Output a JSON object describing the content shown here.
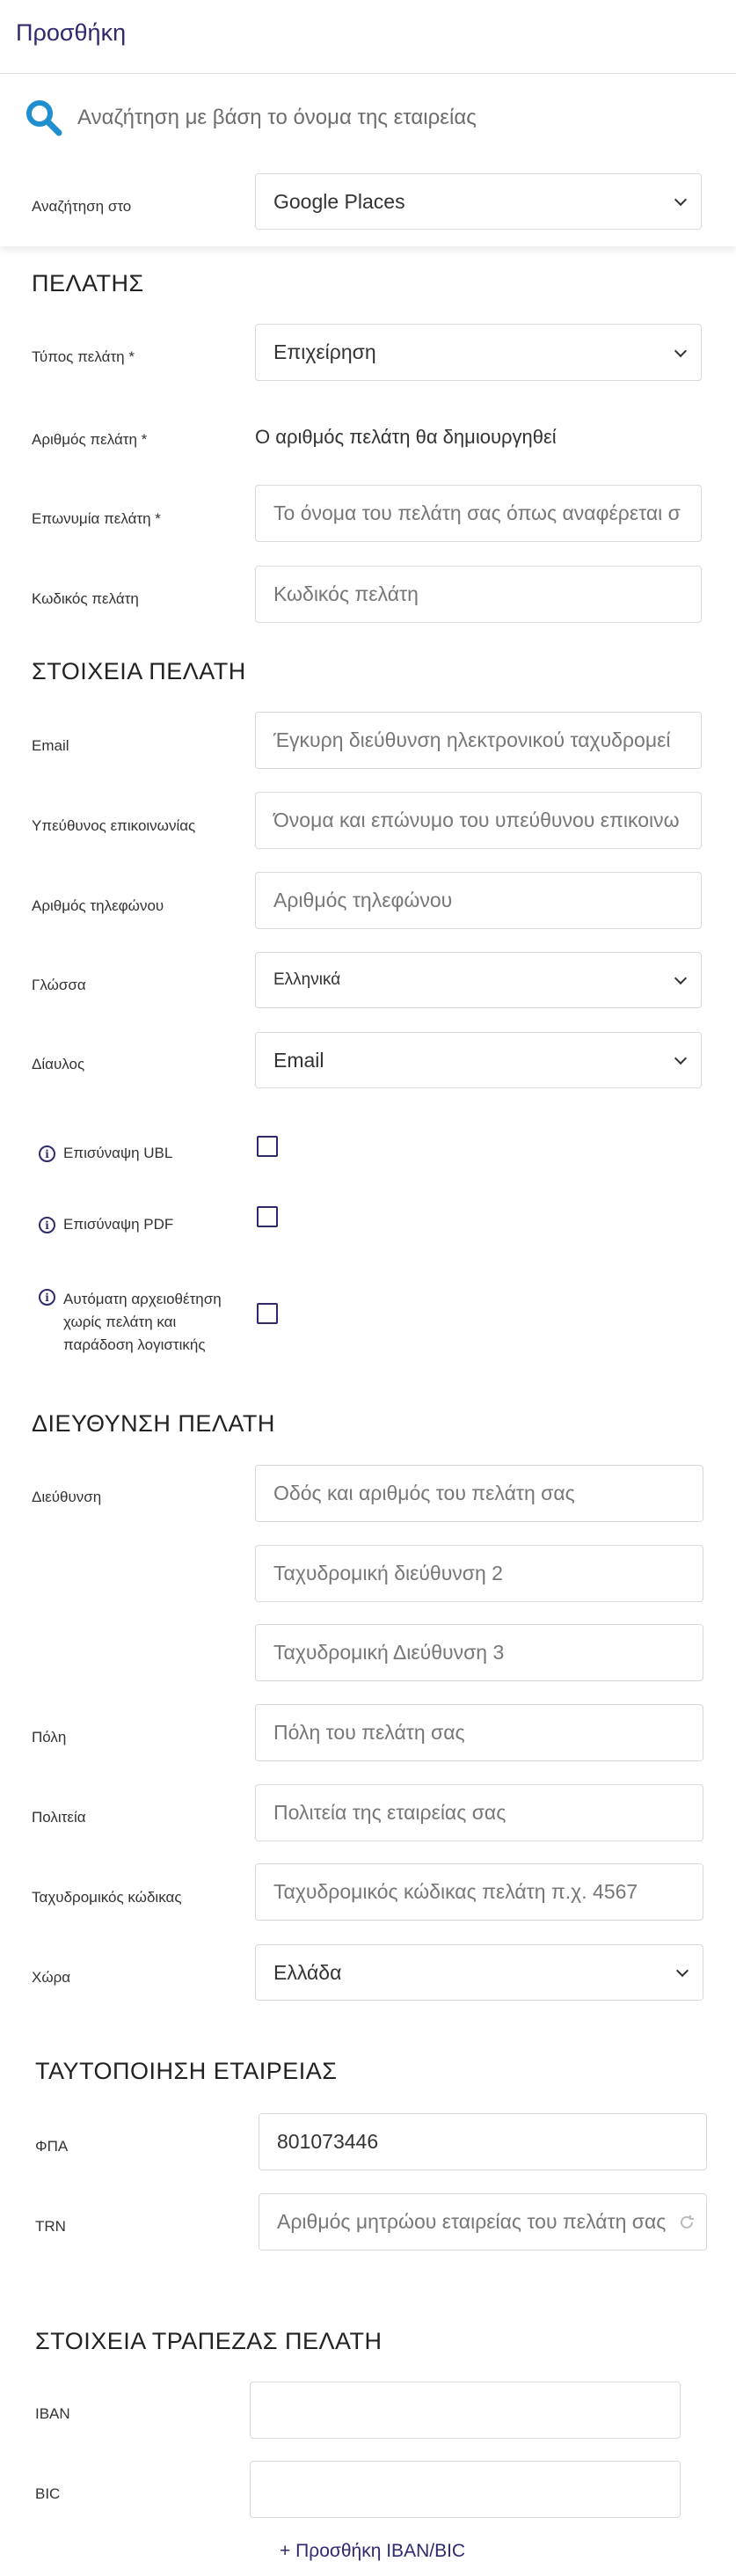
{
  "header": {
    "title": "Προσθήκη"
  },
  "search": {
    "placeholder": "Αναζήτηση με βάση το όνομα της εταιρείας",
    "search_in_label": "Αναζήτηση στο",
    "search_in_value": "Google Places"
  },
  "customer": {
    "heading": "ΠΕΛΑΤΗΣ",
    "type_label": "Τύπος πελάτη *",
    "type_value": "Επιχείρηση",
    "number_label": "Αριθμός πελάτη *",
    "number_value": "Ο αριθμός πελάτη θα δημιουργηθεί",
    "name_label": "Επωνυμία πελάτη *",
    "name_placeholder": "Το όνομα του πελάτη σας όπως αναφέρεται σ",
    "code_label": "Κωδικός πελάτη",
    "code_placeholder": "Κωδικός πελάτη"
  },
  "details": {
    "heading": "ΣΤΟΙΧΕΙΑ ΠΕΛΑΤΗ",
    "email_label": "Email",
    "email_placeholder": "Έγκυρη διεύθυνση ηλεκτρονικού ταχυδρομεί",
    "contact_label": "Υπεύθυνος επικοινωνίας",
    "contact_placeholder": "Όνομα και επώνυμο του υπεύθυνου επικοινω",
    "phone_label": "Αριθμός τηλεφώνου",
    "phone_placeholder": "Αριθμός τηλεφώνου",
    "language_label": "Γλώσσα",
    "language_value": "Ελληνικά",
    "channel_label": "Δίαυλος",
    "channel_value": "Email",
    "ubl_label": "Επισύναψη UBL",
    "pdf_label": "Επισύναψη PDF",
    "auto_label_1": "Αυτόματη αρχειοθέτηση",
    "auto_label_2": "χωρίς πελάτη και",
    "auto_label_3": "παράδοση λογιστικής"
  },
  "address": {
    "heading": "ΔΙΕΥΘΥΝΣΗ ΠΕΛΑΤΗ",
    "address_label": "Διεύθυνση",
    "street_placeholder": "Οδός και αριθμός του πελάτη σας",
    "line2_placeholder": "Ταχυδρομική διεύθυνση 2",
    "line3_placeholder": "Ταχυδρομική Διεύθυνση 3",
    "city_label": "Πόλη",
    "city_placeholder": "Πόλη του πελάτη σας",
    "state_label": "Πολιτεία",
    "state_placeholder": "Πολιτεία της εταιρείας σας",
    "zip_label": "Ταχυδρομικός κώδικας",
    "zip_placeholder": "Ταχυδρομικός κώδικας πελάτη π.χ. 4567",
    "country_label": "Χώρα",
    "country_value": "Ελλάδα"
  },
  "company_id": {
    "heading": "ΤΑΥΤΟΠΟΙΗΣΗ ΕΤΑΙΡΕΙΑΣ",
    "vat_label": "ΦΠΑ",
    "vat_value": "801073446",
    "trn_label": "TRN",
    "trn_placeholder": "Αριθμός μητρώου εταιρείας του πελάτη σας"
  },
  "bank": {
    "heading": "ΣΤΟΙΧΕΙΑ ΤΡΑΠΕΖΑΣ ΠΕΛΑΤΗ",
    "iban_label": "IBAN",
    "iban_value": "",
    "bic_label": "BIC",
    "bic_value": "",
    "add_link": "+ Προσθήκη IBAN/BIC"
  },
  "colors": {
    "accent": "#2e2a6e",
    "search_icon": "#1f8fd0"
  }
}
